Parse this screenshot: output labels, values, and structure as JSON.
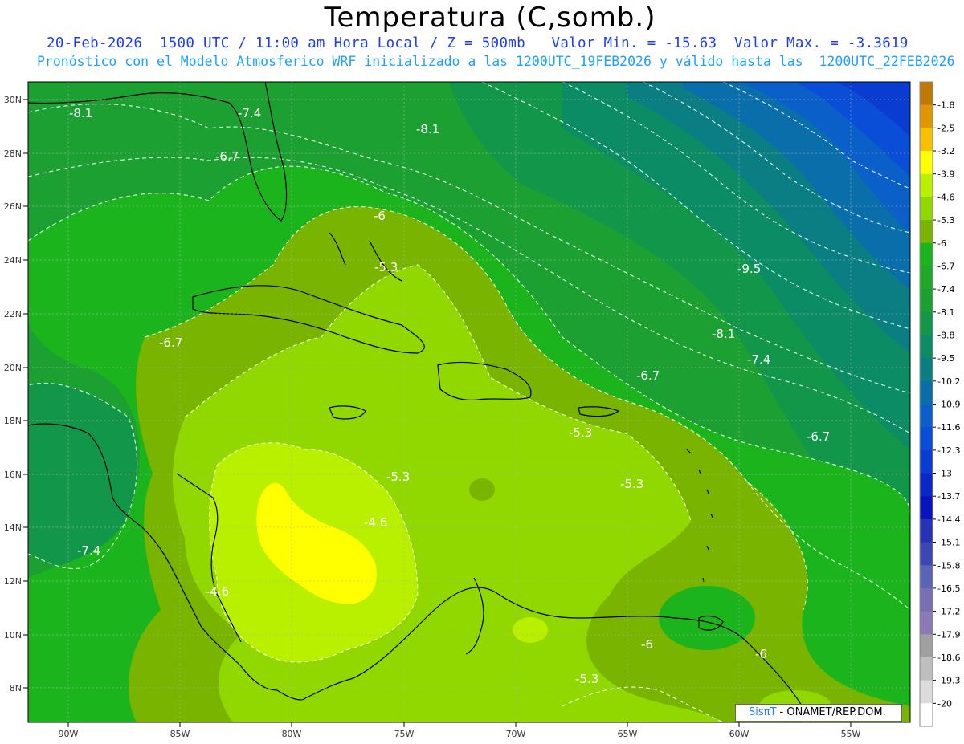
{
  "header": {
    "title": "Temperatura (C,somb.)",
    "line1": "20-Feb-2026  1500 UTC / 11:00 am Hora Local / Z = 500mb   Valor Min. = -15.63  Valor Max. = -3.3619",
    "line2": "Pronóstico con el Modelo Atmosferico WRF inicializado a las 1200UTC_19FEB2026 y válido hasta las  1200UTC_22FEB2026"
  },
  "credit": {
    "sis": "SisπT",
    "rest": " - ONAMET/REP.DOM."
  },
  "axes": {
    "lat_labels": [
      "30N",
      "28N",
      "26N",
      "24N",
      "22N",
      "20N",
      "18N",
      "16N",
      "14N",
      "12N",
      "10N",
      "8N"
    ],
    "lon_labels": [
      "90W",
      "85W",
      "80W",
      "75W",
      "70W",
      "65W",
      "60W",
      "55W"
    ]
  },
  "colorbar": {
    "labels": [
      "-1.8",
      "-2.5",
      "-3.2",
      "-3.9",
      "-4.6",
      "-5.3",
      "-6",
      "-6.7",
      "-7.4",
      "-8.1",
      "-8.8",
      "-9.5",
      "-10.2",
      "-10.9",
      "-11.6",
      "-12.3",
      "-13",
      "-13.7",
      "-14.4",
      "-15.1",
      "-15.8",
      "-16.5",
      "-17.2",
      "-17.9",
      "-18.6",
      "-19.3",
      "-20"
    ],
    "colors": [
      "#c07800",
      "#e09600",
      "#f8c000",
      "#ffff00",
      "#b8f000",
      "#90d800",
      "#78b400",
      "#1cb41c",
      "#1eaa28",
      "#1ca032",
      "#12964a",
      "#0c8c64",
      "#0a7e82",
      "#0a6eaa",
      "#0a60c8",
      "#0a4ed8",
      "#0a3cd2",
      "#0a28c8",
      "#0a14be",
      "#2832b4",
      "#3c46b4",
      "#5a64b4",
      "#786eb4",
      "#8c7ab4",
      "#a0a0a0",
      "#bebebe",
      "#dcdcdc",
      "#ffffff"
    ]
  },
  "contour_labels": [
    "-8.1",
    "-7.4",
    "-6.7",
    "-8.1",
    "-6",
    "-5.3",
    "-9.5",
    "-8.1",
    "-7.4",
    "-6.7",
    "-6.7",
    "-5.3",
    "-6.7",
    "-5.3",
    "-5.3",
    "-4.6",
    "-7.4",
    "-4.6",
    "-6",
    "-6",
    "-5.3"
  ]
}
